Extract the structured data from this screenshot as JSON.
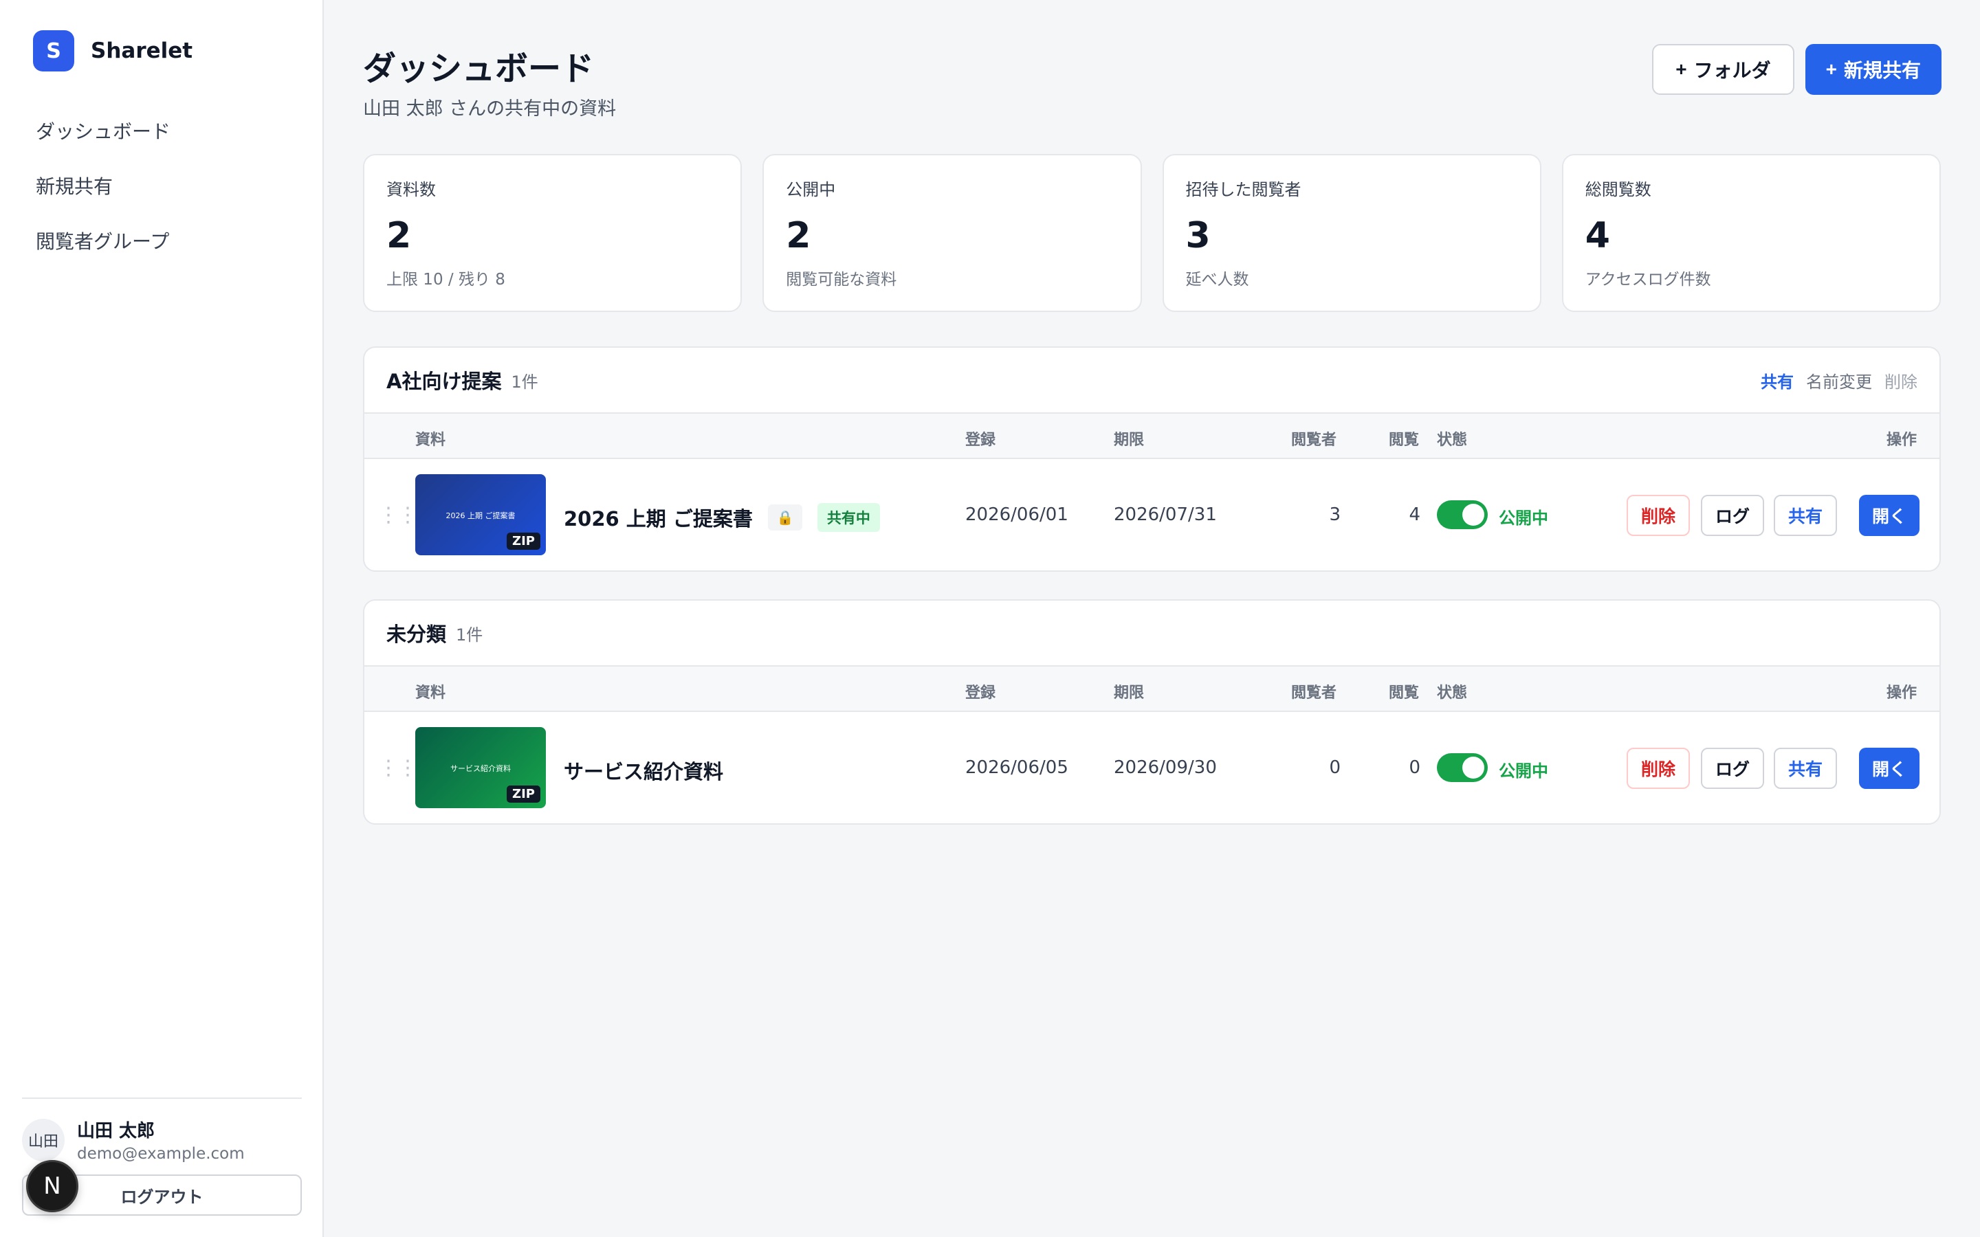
{
  "brand": {
    "logo_letter": "S",
    "name": "Sharelet"
  },
  "nav": [
    {
      "label": "ダッシュボード"
    },
    {
      "label": "新規共有"
    },
    {
      "label": "閲覧者グループ"
    }
  ],
  "user": {
    "avatar_text": "山田",
    "name": "山田 太郎",
    "email": "demo@example.com",
    "logout_label": "ログアウト"
  },
  "next_badge": "N",
  "header": {
    "title": "ダッシュボード",
    "subtitle": "山田 太郎 さんの共有中の資料",
    "folder_btn": "フォルダ",
    "new_share_btn": "新規共有",
    "plus": "+"
  },
  "stats": [
    {
      "label": "資料数",
      "value": "2",
      "note": "上限 10 / 残り 8"
    },
    {
      "label": "公開中",
      "value": "2",
      "note": "閲覧可能な資料"
    },
    {
      "label": "招待した閲覧者",
      "value": "3",
      "note": "延べ人数"
    },
    {
      "label": "総閲覧数",
      "value": "4",
      "note": "アクセスログ件数"
    }
  ],
  "columns": {
    "doc": "資料",
    "registered": "登録",
    "expires": "期限",
    "viewers": "閲覧者",
    "views": "閲覧",
    "status": "状態",
    "actions": "操作"
  },
  "folders": [
    {
      "name": "A社向け提案",
      "count": "1件",
      "actions": {
        "share": "共有",
        "rename": "名前変更",
        "delete": "削除"
      },
      "item": {
        "thumb_text": "2026 上期 ご提案書",
        "file_type": "ZIP",
        "title": "2026 上期 ご提案書",
        "lock_icon": "🔒",
        "shared_badge": "共有中",
        "registered": "2026/06/01",
        "expires": "2026/07/31",
        "viewers": "3",
        "views": "4",
        "status": "公開中",
        "btn_delete": "削除",
        "btn_log": "ログ",
        "btn_share": "共有",
        "btn_open": "開く"
      }
    },
    {
      "name": "未分類",
      "count": "1件",
      "item": {
        "thumb_text": "サービス紹介資料",
        "file_type": "ZIP",
        "title": "サービス紹介資料",
        "registered": "2026/06/05",
        "expires": "2026/09/30",
        "viewers": "0",
        "views": "0",
        "status": "公開中",
        "btn_delete": "削除",
        "btn_log": "ログ",
        "btn_share": "共有",
        "btn_open": "開く"
      }
    }
  ]
}
